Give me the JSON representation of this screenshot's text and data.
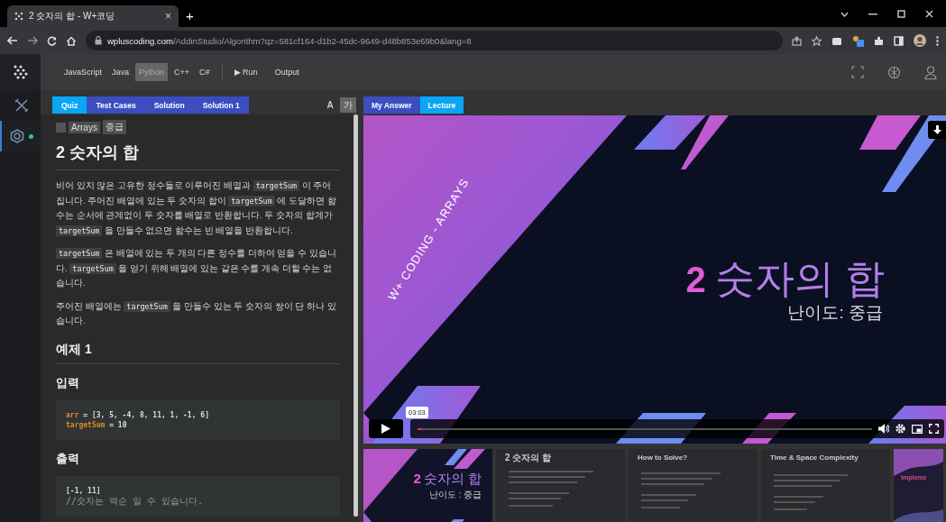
{
  "browser": {
    "tab_title": "2 숫자의 합 - W+코딩",
    "tab_close": "×",
    "new_tab": "+",
    "url": {
      "host": "wpluscoding.com",
      "path": "/AddinStudio/Algorithm?qz=581cf164-d1b2-45dc-9649-d48b853e69b0&lang=8"
    }
  },
  "sidebar": {
    "items": [
      {
        "kind": "tools",
        "selected": false
      },
      {
        "kind": "hexagon",
        "selected": true
      }
    ]
  },
  "toolbar": {
    "languages": [
      {
        "label": "JavaScript",
        "selected": false
      },
      {
        "label": "Java",
        "selected": false
      },
      {
        "label": "Python",
        "selected": true
      },
      {
        "label": "C++",
        "selected": false
      },
      {
        "label": "C#",
        "selected": false
      }
    ],
    "run": {
      "icon": "▶",
      "label": "Run"
    },
    "output": "Output"
  },
  "quiz_panel": {
    "tabs": [
      {
        "label": "Quiz",
        "selected": true
      },
      {
        "label": "Test Cases",
        "selected": false
      },
      {
        "label": "Solution",
        "selected": false
      },
      {
        "label": "Solution 1",
        "selected": false
      }
    ],
    "font_buttons": [
      {
        "label": "A",
        "selected": false
      },
      {
        "label": "가",
        "selected": true
      }
    ],
    "tags": [
      "Arrays",
      "중급"
    ],
    "title": "2 숫자의 합",
    "paragraphs": [
      {
        "parts": [
          {
            "kind": "text",
            "text": "비어 있지 않은 고유한 정수들로 이루어진 배열과 "
          },
          {
            "kind": "code",
            "text": "targetSum"
          },
          {
            "kind": "text",
            "text": " 이 주어집니다. 주어진 배열에 있는 두 숫자의 합이 "
          },
          {
            "kind": "code",
            "text": "targetSum"
          },
          {
            "kind": "text",
            "text": " 에 도달하면 함수는 순서에 관계없이 두 숫자를 배열로 반환합니다. 두 숫자의 합계가 "
          },
          {
            "kind": "code",
            "text": "targetSum"
          },
          {
            "kind": "text",
            "text": " 을 만들수 없으면 함수는 빈 배열을 반환합니다."
          }
        ]
      },
      {
        "parts": [
          {
            "kind": "code",
            "text": "targetSum"
          },
          {
            "kind": "text",
            "text": " 은 배열에 있는 두 개의 다른 정수를 더하여 얻을 수 있습니다. "
          },
          {
            "kind": "code",
            "text": "targetSum"
          },
          {
            "kind": "text",
            "text": " 을 얻기 위해 배열에 있는 같은 수를 계속 더할 수는 없습니다."
          }
        ]
      },
      {
        "parts": [
          {
            "kind": "text",
            "text": "주어진 배열에는 "
          },
          {
            "kind": "code",
            "text": "targetSum"
          },
          {
            "kind": "text",
            "text": " 을 만들수 있는 두 숫자의 쌍이 단 하나 있습니다."
          }
        ]
      }
    ],
    "example": {
      "heading": "예제 1",
      "sections": [
        {
          "heading": "입력",
          "lines": [
            {
              "parts": [
                {
                  "kind": "var",
                  "text": "arr"
                },
                {
                  "kind": "plain",
                  "text": " = [3, 5, -4, 8, 11, 1, -1, 6]"
                }
              ]
            },
            {
              "parts": [
                {
                  "kind": "var",
                  "text": "targetSum"
                },
                {
                  "kind": "plain",
                  "text": " = 10"
                }
              ]
            }
          ]
        },
        {
          "heading": "출력",
          "lines": [
            {
              "parts": [
                {
                  "kind": "plain",
                  "text": "[-1, 11]"
                }
              ]
            },
            {
              "parts": [
                {
                  "kind": "comment",
                  "text": "//숫자는 역순 일 수 있습니다."
                }
              ]
            }
          ]
        }
      ]
    }
  },
  "lecture_panel": {
    "tabs": [
      {
        "label": "My Answer",
        "selected": false
      },
      {
        "label": "Lecture",
        "selected": true
      }
    ],
    "slide": {
      "number": "2",
      "title": "숫자의 합",
      "subtitle": "난이도: 중급",
      "side_text": "W+ CODING - ARRAYS"
    },
    "player": {
      "time_tooltip": "03:03",
      "level": 0.01
    },
    "thumbnails": [
      {
        "kind": "title",
        "number": "2",
        "title": "숫자의 합",
        "subtitle": "난이도 : 중급"
      },
      {
        "kind": "text",
        "title": "2 숫자의 합"
      },
      {
        "kind": "text",
        "title": "How to Solve?"
      },
      {
        "kind": "text",
        "title": "Time & Space Complexity"
      },
      {
        "kind": "cut",
        "title": "Impleme"
      }
    ]
  }
}
